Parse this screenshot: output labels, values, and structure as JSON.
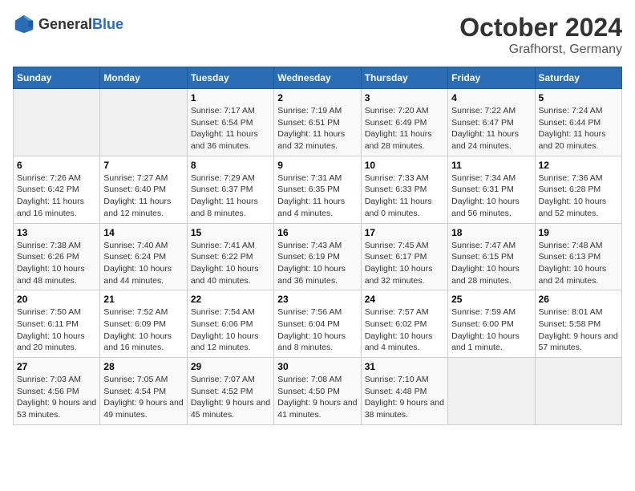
{
  "header": {
    "logo_general": "General",
    "logo_blue": "Blue",
    "month": "October 2024",
    "location": "Grafhorst, Germany"
  },
  "weekdays": [
    "Sunday",
    "Monday",
    "Tuesday",
    "Wednesday",
    "Thursday",
    "Friday",
    "Saturday"
  ],
  "weeks": [
    [
      {
        "day": "",
        "detail": "",
        "empty": true
      },
      {
        "day": "",
        "detail": "",
        "empty": true
      },
      {
        "day": "1",
        "detail": "Sunrise: 7:17 AM\nSunset: 6:54 PM\nDaylight: 11 hours and 36 minutes."
      },
      {
        "day": "2",
        "detail": "Sunrise: 7:19 AM\nSunset: 6:51 PM\nDaylight: 11 hours and 32 minutes."
      },
      {
        "day": "3",
        "detail": "Sunrise: 7:20 AM\nSunset: 6:49 PM\nDaylight: 11 hours and 28 minutes."
      },
      {
        "day": "4",
        "detail": "Sunrise: 7:22 AM\nSunset: 6:47 PM\nDaylight: 11 hours and 24 minutes."
      },
      {
        "day": "5",
        "detail": "Sunrise: 7:24 AM\nSunset: 6:44 PM\nDaylight: 11 hours and 20 minutes."
      }
    ],
    [
      {
        "day": "6",
        "detail": "Sunrise: 7:26 AM\nSunset: 6:42 PM\nDaylight: 11 hours and 16 minutes."
      },
      {
        "day": "7",
        "detail": "Sunrise: 7:27 AM\nSunset: 6:40 PM\nDaylight: 11 hours and 12 minutes."
      },
      {
        "day": "8",
        "detail": "Sunrise: 7:29 AM\nSunset: 6:37 PM\nDaylight: 11 hours and 8 minutes."
      },
      {
        "day": "9",
        "detail": "Sunrise: 7:31 AM\nSunset: 6:35 PM\nDaylight: 11 hours and 4 minutes."
      },
      {
        "day": "10",
        "detail": "Sunrise: 7:33 AM\nSunset: 6:33 PM\nDaylight: 11 hours and 0 minutes."
      },
      {
        "day": "11",
        "detail": "Sunrise: 7:34 AM\nSunset: 6:31 PM\nDaylight: 10 hours and 56 minutes."
      },
      {
        "day": "12",
        "detail": "Sunrise: 7:36 AM\nSunset: 6:28 PM\nDaylight: 10 hours and 52 minutes."
      }
    ],
    [
      {
        "day": "13",
        "detail": "Sunrise: 7:38 AM\nSunset: 6:26 PM\nDaylight: 10 hours and 48 minutes."
      },
      {
        "day": "14",
        "detail": "Sunrise: 7:40 AM\nSunset: 6:24 PM\nDaylight: 10 hours and 44 minutes."
      },
      {
        "day": "15",
        "detail": "Sunrise: 7:41 AM\nSunset: 6:22 PM\nDaylight: 10 hours and 40 minutes."
      },
      {
        "day": "16",
        "detail": "Sunrise: 7:43 AM\nSunset: 6:19 PM\nDaylight: 10 hours and 36 minutes."
      },
      {
        "day": "17",
        "detail": "Sunrise: 7:45 AM\nSunset: 6:17 PM\nDaylight: 10 hours and 32 minutes."
      },
      {
        "day": "18",
        "detail": "Sunrise: 7:47 AM\nSunset: 6:15 PM\nDaylight: 10 hours and 28 minutes."
      },
      {
        "day": "19",
        "detail": "Sunrise: 7:48 AM\nSunset: 6:13 PM\nDaylight: 10 hours and 24 minutes."
      }
    ],
    [
      {
        "day": "20",
        "detail": "Sunrise: 7:50 AM\nSunset: 6:11 PM\nDaylight: 10 hours and 20 minutes."
      },
      {
        "day": "21",
        "detail": "Sunrise: 7:52 AM\nSunset: 6:09 PM\nDaylight: 10 hours and 16 minutes."
      },
      {
        "day": "22",
        "detail": "Sunrise: 7:54 AM\nSunset: 6:06 PM\nDaylight: 10 hours and 12 minutes."
      },
      {
        "day": "23",
        "detail": "Sunrise: 7:56 AM\nSunset: 6:04 PM\nDaylight: 10 hours and 8 minutes."
      },
      {
        "day": "24",
        "detail": "Sunrise: 7:57 AM\nSunset: 6:02 PM\nDaylight: 10 hours and 4 minutes."
      },
      {
        "day": "25",
        "detail": "Sunrise: 7:59 AM\nSunset: 6:00 PM\nDaylight: 10 hours and 1 minute."
      },
      {
        "day": "26",
        "detail": "Sunrise: 8:01 AM\nSunset: 5:58 PM\nDaylight: 9 hours and 57 minutes."
      }
    ],
    [
      {
        "day": "27",
        "detail": "Sunrise: 7:03 AM\nSunset: 4:56 PM\nDaylight: 9 hours and 53 minutes."
      },
      {
        "day": "28",
        "detail": "Sunrise: 7:05 AM\nSunset: 4:54 PM\nDaylight: 9 hours and 49 minutes."
      },
      {
        "day": "29",
        "detail": "Sunrise: 7:07 AM\nSunset: 4:52 PM\nDaylight: 9 hours and 45 minutes."
      },
      {
        "day": "30",
        "detail": "Sunrise: 7:08 AM\nSunset: 4:50 PM\nDaylight: 9 hours and 41 minutes."
      },
      {
        "day": "31",
        "detail": "Sunrise: 7:10 AM\nSunset: 4:48 PM\nDaylight: 9 hours and 38 minutes."
      },
      {
        "day": "",
        "detail": "",
        "empty": true
      },
      {
        "day": "",
        "detail": "",
        "empty": true
      }
    ]
  ]
}
